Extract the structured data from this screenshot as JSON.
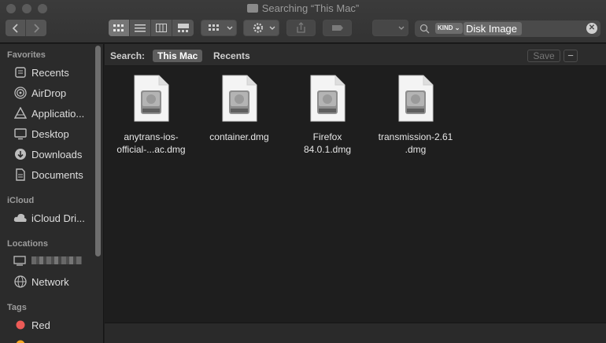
{
  "window": {
    "title": "Searching “This Mac”"
  },
  "toolbar": {
    "back_icon": "chevron-left-icon",
    "forward_icon": "chevron-right-icon",
    "view_modes": [
      "icon-view-icon",
      "list-view-icon",
      "column-view-icon",
      "gallery-view-icon"
    ],
    "active_view": "icon-view-icon"
  },
  "search": {
    "kind_chip": "KIND",
    "token": "Disk Image"
  },
  "scope_bar": {
    "label": "Search:",
    "active_scope": "This Mac",
    "other_scope": "Recents",
    "save_label": "Save",
    "remove_label": "−"
  },
  "sidebar": {
    "favorites_header": "Favorites",
    "favorites": [
      {
        "label": "Recents",
        "icon": "clock-icon"
      },
      {
        "label": "AirDrop",
        "icon": "airdrop-icon"
      },
      {
        "label": "Applicatio...",
        "icon": "applications-icon"
      },
      {
        "label": "Desktop",
        "icon": "desktop-icon"
      },
      {
        "label": "Downloads",
        "icon": "downloads-icon"
      },
      {
        "label": "Documents",
        "icon": "documents-icon"
      }
    ],
    "icloud_header": "iCloud",
    "icloud": [
      {
        "label": "iCloud Dri...",
        "icon": "cloud-icon"
      }
    ],
    "locations_header": "Locations",
    "locations": [
      {
        "label": "Network",
        "icon": "network-icon"
      }
    ],
    "tags_header": "Tags",
    "tags": [
      {
        "label": "Red",
        "color": "#ed5b57"
      },
      {
        "label": "",
        "color": "#f5a623"
      }
    ]
  },
  "files": [
    {
      "line1": "anytrans-ios-",
      "line2": "official-...ac.dmg"
    },
    {
      "line1": "container.dmg",
      "line2": ""
    },
    {
      "line1": "Firefox",
      "line2": "84.0.1.dmg"
    },
    {
      "line1": "transmission-2.61",
      "line2": ".dmg"
    }
  ],
  "colors": {
    "window_bg": "#1e1e1e",
    "sidebar_bg": "#2b2b2b",
    "red_tag": "#ed5b57"
  }
}
